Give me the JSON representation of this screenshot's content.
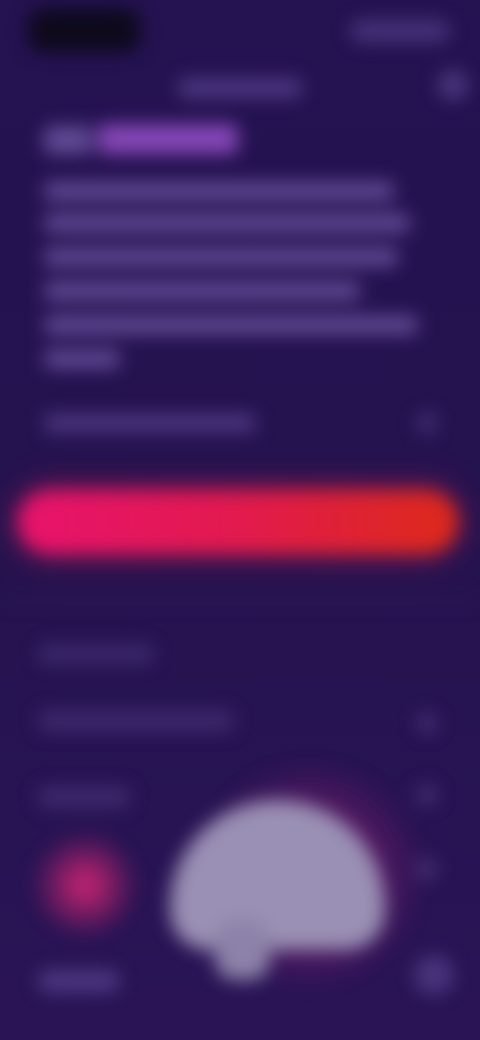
{
  "theme": {
    "background": "#24124f",
    "accent_start": "#e8136d",
    "accent_end": "#dc2a1a"
  },
  "icons": {
    "close": "close-icon",
    "chevron": "chevron-right-icon",
    "bottom_right": "menu-icon"
  }
}
